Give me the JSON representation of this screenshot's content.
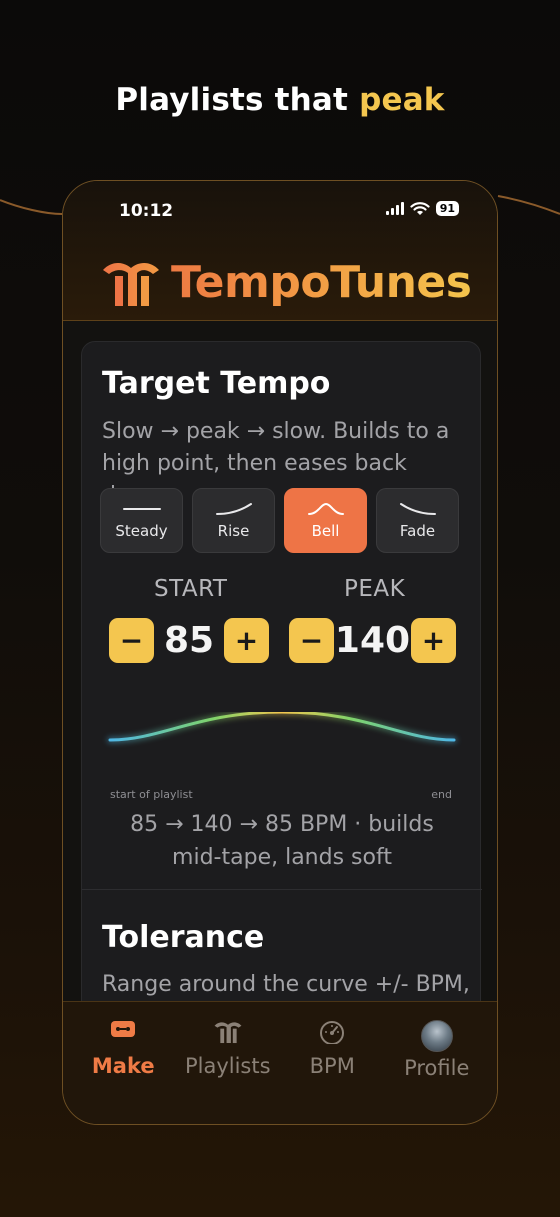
{
  "headline": {
    "prefix": "Playlists that",
    "accent": "peak"
  },
  "status": {
    "time": "10:12",
    "battery": "91"
  },
  "app": {
    "name": "TempoTunes"
  },
  "target_tempo": {
    "title": "Target Tempo",
    "description": "Slow → peak → slow. Builds to a high point, then eases back down.",
    "shapes": [
      {
        "label": "Steady",
        "icon": "flat-line-icon",
        "active": false
      },
      {
        "label": "Rise",
        "icon": "rise-curve-icon",
        "active": false
      },
      {
        "label": "Bell",
        "icon": "bell-curve-icon",
        "active": true
      },
      {
        "label": "Fade",
        "icon": "fade-curve-icon",
        "active": false
      }
    ],
    "start": {
      "label": "START",
      "value": "85",
      "minus": "−",
      "plus": "+"
    },
    "peak": {
      "label": "PEAK",
      "value": "140",
      "minus": "−",
      "plus": "+"
    },
    "curve": {
      "axis_start": "start of playlist",
      "axis_end": "end",
      "colors": [
        "#4fb7e6",
        "#7fd36a",
        "#f4c64f"
      ]
    },
    "summary": "85 → 140 → 85 BPM · builds mid-tape, lands soft"
  },
  "tolerance": {
    "title": "Tolerance",
    "description": "Range around the curve +/- BPM,"
  },
  "tabs": [
    {
      "label": "Make",
      "icon": "make-icon",
      "active": true
    },
    {
      "label": "Playlists",
      "icon": "tempotunes-logo-icon",
      "active": false
    },
    {
      "label": "BPM",
      "icon": "speedometer-icon",
      "active": false
    },
    {
      "label": "Profile",
      "icon": "avatar",
      "active": false
    }
  ],
  "colors": {
    "accent_orange": "#ee7446",
    "accent_yellow": "#f4c64f",
    "background": "#131210"
  }
}
